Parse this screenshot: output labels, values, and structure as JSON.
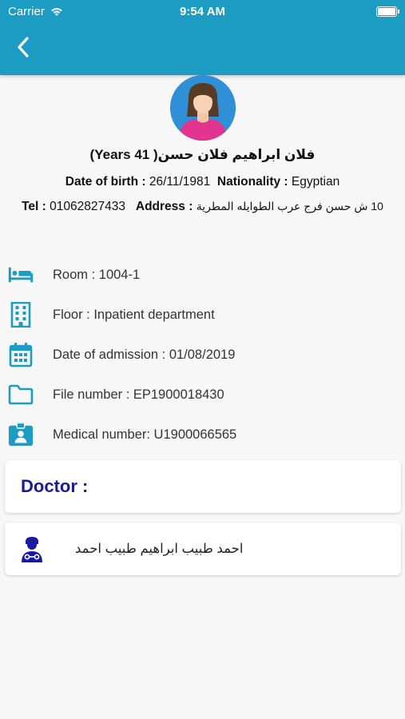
{
  "status_bar": {
    "carrier": "Carrier",
    "time": "9:54 AM"
  },
  "header": {
    "back_icon": "chevron-left-icon"
  },
  "patient": {
    "name": "فلان ابراهيم فلان حسن( 41 Years)",
    "dob_label": "Date of birth :",
    "dob_value": "26/11/1981",
    "nationality_label": "Nationality :",
    "nationality_value": "Egyptian",
    "tel_label": "Tel :",
    "tel_value": "01062827433",
    "address_label": "Address :",
    "address_value": "10 ش حسن فرج عرب الطوايله المطرية"
  },
  "details": [
    {
      "icon": "bed-icon",
      "text": "Room : 1004-1"
    },
    {
      "icon": "building-icon",
      "text": "Floor : Inpatient department"
    },
    {
      "icon": "calendar-icon",
      "text": "Date of admission : 01/08/2019"
    },
    {
      "icon": "folder-icon",
      "text": "File number : EP1900018430"
    },
    {
      "icon": "id-badge-icon",
      "text": "Medical number: U1900066565"
    }
  ],
  "doctor_section": {
    "title": "Doctor :"
  },
  "doctor": {
    "icon": "doctor-icon",
    "name": "احمد طبيب ابراهيم طبيب احمد"
  },
  "colors": {
    "header": "#1c9bc3",
    "icon": "#1c9bc3",
    "doctor_title": "#1a1aa0",
    "doctor_icon": "#1a1aa0"
  }
}
